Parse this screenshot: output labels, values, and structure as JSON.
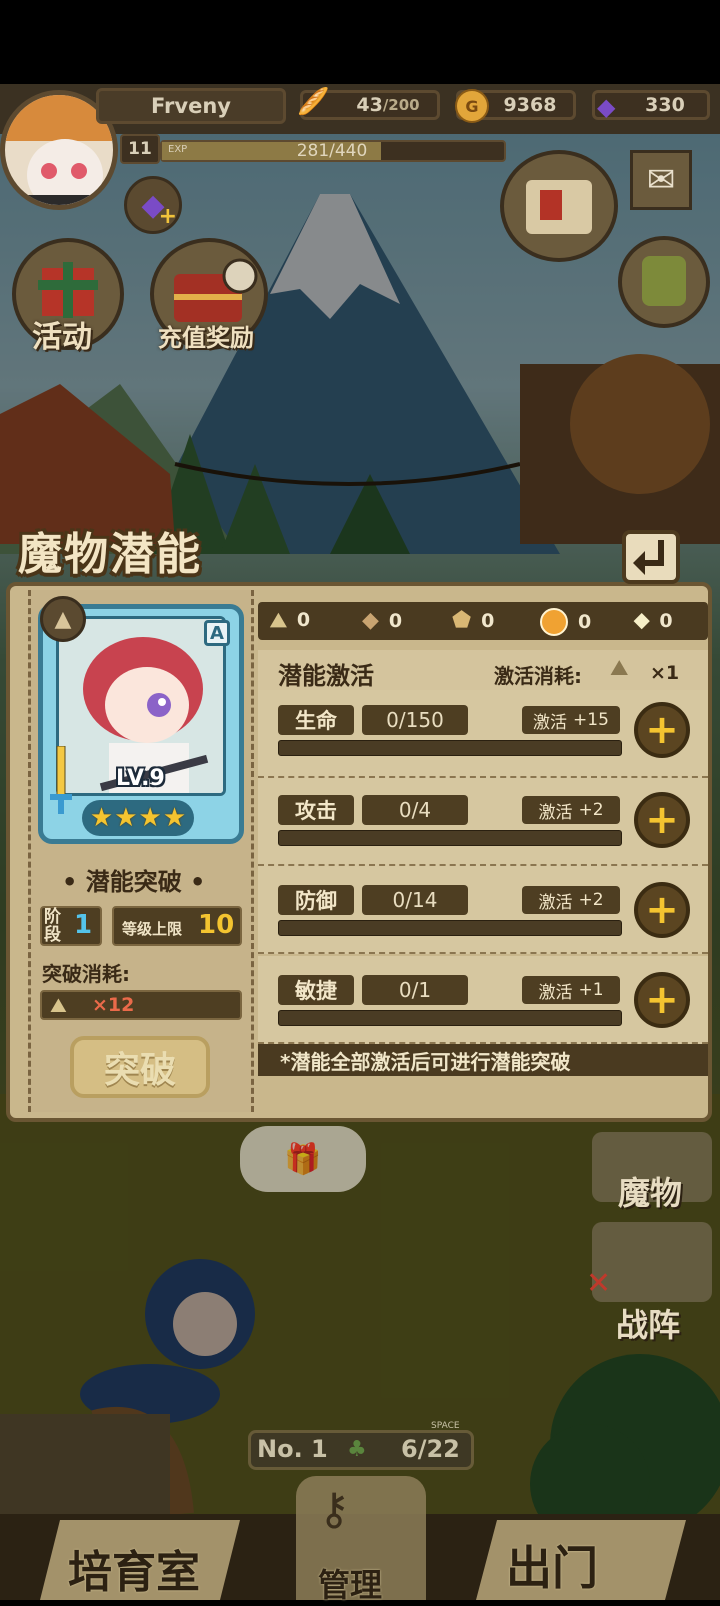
{
  "player": {
    "name": "Frveny",
    "level": "11",
    "exp_label": "EXP",
    "exp": "281/440"
  },
  "resources": {
    "stamina": "43",
    "stamina_max": "/200",
    "gold": "9368",
    "gems": "330"
  },
  "side_buttons": {
    "activity": "活动",
    "recharge": "充值奖励"
  },
  "panel": {
    "title": "魔物潜能",
    "monster": {
      "level": "LV.9",
      "rank": "A",
      "stars": 4
    },
    "breakthrough": {
      "heading": "• 潜能突破 •",
      "stage_label": "阶段",
      "stage": "1",
      "cap_label": "等级上限",
      "cap": "10",
      "cost_label": "突破消耗:",
      "cost": "×12",
      "button": "突破"
    },
    "materials": [
      "0",
      "0",
      "0",
      "0",
      "0"
    ],
    "activation": {
      "heading": "潜能激活",
      "cost_label": "激活消耗:",
      "cost": "×1",
      "activate_label": "激活",
      "stats": [
        {
          "name": "生命",
          "value": "0/150",
          "bonus": "+15",
          "progress": 0
        },
        {
          "name": "攻击",
          "value": "0/4",
          "bonus": "+2",
          "progress": 0
        },
        {
          "name": "防御",
          "value": "0/14",
          "bonus": "+2",
          "progress": 0
        },
        {
          "name": "敏捷",
          "value": "0/1",
          "bonus": "+1",
          "progress": 0
        }
      ]
    },
    "note": "*潜能全部激活后可进行潜能突破"
  },
  "right_menu": {
    "monsters": "魔物",
    "formation": "战阵"
  },
  "space": {
    "rank": "No. 1",
    "space_label": "SPACE",
    "count": "6/22"
  },
  "bottom_nav": {
    "nursery": "培育室",
    "manage": "管理",
    "exit": "出门"
  },
  "colors": {
    "panel_bg": "#c9b78c",
    "panel_border": "#6a5633",
    "accent_gold": "#f4c430",
    "card_blue": "#8dd3e6"
  }
}
